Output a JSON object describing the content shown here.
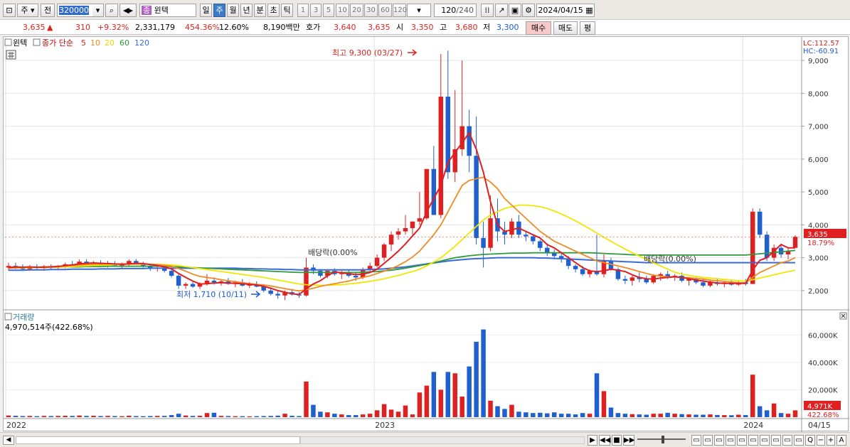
{
  "toolbar": {
    "period_label": "주",
    "prev_label": "전",
    "stock_code": "320000",
    "stock_badge": "종",
    "stock_name": "윈텍",
    "intervals": [
      "일",
      "주",
      "월",
      "년",
      "분",
      "초",
      "틱"
    ],
    "presets": [
      "1",
      "3",
      "5",
      "10",
      "20",
      "30",
      "60",
      "120"
    ],
    "count_value": "120",
    "count_total": "/240",
    "date_value": "2024/04/15"
  },
  "info": {
    "price": "3,635",
    "change": "310",
    "change_pct": "+9.32%",
    "volume": "2,331,179",
    "volume_ratio": "454.36%",
    "turnover": "12.60%",
    "amount": "8,190백만",
    "quote_label": "호가",
    "ask": "3,640",
    "bid": "3,635",
    "open_label": "시",
    "open": "3,350",
    "high_label": "고",
    "high": "3,680",
    "low_label": "저",
    "low": "3,300",
    "buy_label": "매수",
    "sell_label": "매도",
    "eval_label": "평"
  },
  "chart": {
    "legend_name": "윈텍",
    "legend_ma_title": "종가 단순",
    "legend_ma": [
      {
        "label": "5",
        "color": "#e02020"
      },
      {
        "label": "10",
        "color": "#f08a24"
      },
      {
        "label": "20",
        "color": "#f2e600"
      },
      {
        "label": "60",
        "color": "#2e9a3e"
      },
      {
        "label": "120",
        "color": "#3a6bd8"
      }
    ],
    "lc_label": "LC:112.57",
    "hc_label": "HC:-60.91",
    "price_ticks": [
      "9,000",
      "8,000",
      "7,000",
      "6,000",
      "5,000",
      "4,000",
      "3,000",
      "2,000"
    ],
    "price_tag": "3,635",
    "price_tag_pct": "18.79%",
    "high_note": "최고 9,300 (03/27)",
    "low_note": "최저 1,710 (10/11)",
    "div_note_1": "배당락(0.00%",
    "div_note_2": "배당락(0.00%)",
    "volume_title": "거래량",
    "volume_value": "4,970,514주(422.68%)",
    "volume_ticks": [
      "60,000K",
      "40,000K",
      "20,000K"
    ],
    "volume_tag": "4,971K",
    "volume_tag_pct": "422.68%",
    "x_labels": [
      "2022",
      "2023",
      "2024",
      "04/15"
    ],
    "colors": {
      "up": "#e02020",
      "down": "#1f5fd0"
    }
  },
  "chart_data": {
    "type": "candlestick",
    "title": "윈텍",
    "ylim": [
      1500,
      9500
    ],
    "volume_ylim": [
      0,
      70000
    ],
    "candles": [
      [
        2700,
        2850,
        2600,
        2750,
        1200
      ],
      [
        2750,
        2850,
        2650,
        2700,
        1000
      ],
      [
        2700,
        2800,
        2620,
        2650,
        800
      ],
      [
        2650,
        2780,
        2600,
        2720,
        900
      ],
      [
        2720,
        2800,
        2650,
        2680,
        700
      ],
      [
        2680,
        2780,
        2600,
        2740,
        900
      ],
      [
        2740,
        2800,
        2650,
        2700,
        800
      ],
      [
        2700,
        2780,
        2620,
        2750,
        900
      ],
      [
        2750,
        2850,
        2680,
        2800,
        1000
      ],
      [
        2800,
        2900,
        2720,
        2780,
        900
      ],
      [
        2780,
        2950,
        2700,
        2880,
        1200
      ],
      [
        2880,
        2950,
        2750,
        2800,
        900
      ],
      [
        2800,
        2900,
        2720,
        2850,
        1000
      ],
      [
        2850,
        2920,
        2750,
        2780,
        800
      ],
      [
        2780,
        2900,
        2700,
        2820,
        900
      ],
      [
        2820,
        2900,
        2740,
        2760,
        800
      ],
      [
        2760,
        2850,
        2680,
        2800,
        700
      ],
      [
        2800,
        2950,
        2750,
        2900,
        1000
      ],
      [
        2900,
        2960,
        2780,
        2820,
        800
      ],
      [
        2820,
        2880,
        2700,
        2740,
        700
      ],
      [
        2740,
        2800,
        2600,
        2660,
        800
      ],
      [
        2660,
        2750,
        2580,
        2700,
        900
      ],
      [
        2700,
        2760,
        2550,
        2600,
        900
      ],
      [
        2600,
        2650,
        2400,
        2450,
        1500
      ],
      [
        2450,
        2500,
        2050,
        2150,
        2500
      ],
      [
        2150,
        2250,
        2050,
        2200,
        1200
      ],
      [
        2200,
        2300,
        2080,
        2120,
        900
      ],
      [
        2120,
        2250,
        2050,
        2220,
        1000
      ],
      [
        2220,
        2500,
        2150,
        2300,
        3000
      ],
      [
        2300,
        2400,
        2180,
        2250,
        3200
      ],
      [
        2250,
        2350,
        2150,
        2280,
        900
      ],
      [
        2280,
        2380,
        2180,
        2200,
        800
      ],
      [
        2200,
        2300,
        2100,
        2250,
        700
      ],
      [
        2250,
        2350,
        2120,
        2150,
        700
      ],
      [
        2150,
        2260,
        2080,
        2200,
        600
      ],
      [
        2200,
        2280,
        2100,
        2120,
        700
      ],
      [
        2120,
        2200,
        1950,
        2000,
        800
      ],
      [
        2000,
        2100,
        1850,
        1900,
        900
      ],
      [
        1900,
        1980,
        1750,
        1850,
        1100
      ],
      [
        1850,
        2000,
        1710,
        1950,
        2500
      ],
      [
        1950,
        2050,
        1850,
        1880,
        1000
      ],
      [
        1880,
        1950,
        1780,
        1850,
        800
      ],
      [
        1850,
        3000,
        1820,
        2700,
        26000
      ],
      [
        2700,
        2800,
        2500,
        2600,
        9000
      ],
      [
        2600,
        2650,
        2400,
        2450,
        4000
      ],
      [
        2450,
        2650,
        2380,
        2600,
        3500
      ],
      [
        2600,
        2680,
        2450,
        2500,
        2500
      ],
      [
        2500,
        2600,
        2350,
        2550,
        2000
      ],
      [
        2550,
        2620,
        2400,
        2450,
        1500
      ],
      [
        2450,
        2550,
        2300,
        2400,
        1500
      ],
      [
        2400,
        2700,
        2350,
        2650,
        2000
      ],
      [
        2650,
        2850,
        2550,
        2750,
        2500
      ],
      [
        2750,
        3100,
        2700,
        3000,
        5000
      ],
      [
        3000,
        3450,
        2900,
        3400,
        9500
      ],
      [
        3400,
        3800,
        3200,
        3700,
        5500
      ],
      [
        3700,
        3900,
        3550,
        3800,
        4000
      ],
      [
        3800,
        4300,
        3700,
        3900,
        8500
      ],
      [
        3900,
        4100,
        3700,
        4100,
        2000
      ],
      [
        4100,
        5000,
        4000,
        4200,
        18000
      ],
      [
        4200,
        5200,
        4150,
        5700,
        23000
      ],
      [
        5700,
        6400,
        4300,
        4300,
        33000
      ],
      [
        4300,
        9200,
        4200,
        7900,
        20000
      ],
      [
        7900,
        9300,
        5400,
        5600,
        33000
      ],
      [
        5600,
        8100,
        5300,
        6300,
        32000
      ],
      [
        6300,
        9000,
        6100,
        7000,
        15000
      ],
      [
        7000,
        7500,
        5600,
        6100,
        37000
      ],
      [
        6100,
        7300,
        3400,
        3600,
        55000
      ],
      [
        3600,
        4100,
        2700,
        3300,
        64000
      ],
      [
        3300,
        4900,
        3200,
        4200,
        12000
      ],
      [
        4200,
        4800,
        3500,
        3800,
        8000
      ],
      [
        3800,
        4100,
        3400,
        3700,
        6000
      ],
      [
        3700,
        4200,
        3600,
        4100,
        9000
      ],
      [
        4100,
        4300,
        3600,
        3700,
        4000
      ],
      [
        3700,
        3800,
        3500,
        3650,
        3500
      ],
      [
        3650,
        3700,
        3400,
        3500,
        3000
      ],
      [
        3500,
        3550,
        3200,
        3300,
        3200
      ],
      [
        3300,
        3400,
        3050,
        3150,
        2800
      ],
      [
        3150,
        3250,
        2950,
        3050,
        3500
      ],
      [
        3050,
        3150,
        2850,
        2950,
        2500
      ],
      [
        2950,
        3050,
        2650,
        2750,
        2500
      ],
      [
        2750,
        2800,
        2550,
        2650,
        2000
      ],
      [
        2650,
        2750,
        2450,
        2500,
        3000
      ],
      [
        2500,
        2650,
        2400,
        2600,
        2500
      ],
      [
        2600,
        3700,
        2450,
        2500,
        32000
      ],
      [
        2500,
        3100,
        2400,
        2900,
        19000
      ],
      [
        2900,
        3000,
        2600,
        2650,
        7000
      ],
      [
        2650,
        2700,
        2300,
        2350,
        3000
      ],
      [
        2350,
        2450,
        2200,
        2300,
        2500
      ],
      [
        2300,
        2450,
        2150,
        2400,
        2200
      ],
      [
        2400,
        2550,
        2250,
        2350,
        2000
      ],
      [
        2350,
        2450,
        2200,
        2250,
        1800
      ],
      [
        2250,
        2500,
        2200,
        2450,
        2500
      ],
      [
        2450,
        2550,
        2300,
        2500,
        2500
      ],
      [
        2500,
        2600,
        2350,
        2400,
        3200
      ],
      [
        2400,
        2500,
        2300,
        2450,
        2500
      ],
      [
        2450,
        2550,
        2250,
        2300,
        2200
      ],
      [
        2300,
        2400,
        2150,
        2350,
        2000
      ],
      [
        2350,
        2400,
        2200,
        2250,
        1800
      ],
      [
        2250,
        2350,
        2100,
        2150,
        1800
      ],
      [
        2150,
        2300,
        2100,
        2250,
        2000
      ],
      [
        2250,
        2350,
        2150,
        2200,
        1600
      ],
      [
        2200,
        2300,
        2100,
        2250,
        1500
      ],
      [
        2250,
        2300,
        2150,
        2180,
        1400
      ],
      [
        2180,
        2300,
        2150,
        2250,
        1800
      ],
      [
        2250,
        2350,
        2150,
        2200,
        1500
      ],
      [
        2200,
        4500,
        2200,
        4400,
        31000
      ],
      [
        4400,
        4500,
        3600,
        3700,
        8000
      ],
      [
        3700,
        3800,
        2900,
        3000,
        5000
      ],
      [
        3000,
        3400,
        2900,
        3300,
        10000
      ],
      [
        3300,
        3400,
        3000,
        3100,
        3000
      ],
      [
        3100,
        3300,
        2950,
        3200,
        2500
      ],
      [
        3300,
        3680,
        3300,
        3635,
        4971
      ]
    ],
    "ma": {
      "5": [
        2700,
        2720,
        2710,
        2720,
        2710,
        2710,
        2720,
        2730,
        2760,
        2780,
        2810,
        2830,
        2840,
        2830,
        2820,
        2810,
        2800,
        2810,
        2830,
        2820,
        2790,
        2760,
        2720,
        2660,
        2520,
        2400,
        2290,
        2200,
        2210,
        2230,
        2240,
        2230,
        2220,
        2210,
        2190,
        2170,
        2130,
        2070,
        2000,
        1950,
        1900,
        1880,
        2050,
        2200,
        2300,
        2450,
        2570,
        2540,
        2510,
        2490,
        2500,
        2550,
        2650,
        2830,
        3010,
        3200,
        3420,
        3660,
        3900,
        4400,
        4800,
        5200,
        5900,
        6200,
        6500,
        6800,
        6300,
        5600,
        4700,
        4000,
        3800,
        3850,
        3900,
        3800,
        3700,
        3600,
        3400,
        3300,
        3150,
        3000,
        2850,
        2700,
        2600,
        2580,
        2600,
        2650,
        2620,
        2580,
        2480,
        2400,
        2360,
        2350,
        2380,
        2400,
        2420,
        2400,
        2360,
        2320,
        2290,
        2260,
        2230,
        2220,
        2220,
        2220,
        2220,
        2620,
        2920,
        3000,
        3200,
        3400,
        3300,
        3300
      ],
      "10": [
        2680,
        2690,
        2700,
        2710,
        2710,
        2720,
        2730,
        2740,
        2750,
        2760,
        2780,
        2790,
        2800,
        2810,
        2810,
        2810,
        2810,
        2810,
        2810,
        2810,
        2800,
        2790,
        2770,
        2740,
        2670,
        2590,
        2500,
        2430,
        2400,
        2370,
        2330,
        2300,
        2270,
        2240,
        2210,
        2190,
        2170,
        2140,
        2100,
        2060,
        2020,
        1990,
        2030,
        2070,
        2130,
        2170,
        2210,
        2250,
        2290,
        2350,
        2400,
        2450,
        2520,
        2590,
        2670,
        2760,
        2880,
        3020,
        3200,
        3450,
        3700,
        4000,
        4400,
        4800,
        5200,
        5350,
        5400,
        5450,
        5300,
        5100,
        4800,
        4600,
        4400,
        4200,
        4000,
        3800,
        3650,
        3500,
        3400,
        3300,
        3200,
        3100,
        3000,
        2900,
        2850,
        2800,
        2750,
        2700,
        2640,
        2580,
        2520,
        2470,
        2440,
        2420,
        2410,
        2400,
        2390,
        2370,
        2350,
        2320,
        2300,
        2280,
        2260,
        2240,
        2230,
        2400,
        2550,
        2650,
        2750,
        2850,
        2900,
        3000
      ],
      "20": [
        2680,
        2690,
        2690,
        2700,
        2700,
        2700,
        2710,
        2710,
        2720,
        2730,
        2740,
        2750,
        2760,
        2770,
        2780,
        2790,
        2800,
        2800,
        2800,
        2800,
        2800,
        2800,
        2790,
        2780,
        2760,
        2730,
        2700,
        2670,
        2640,
        2610,
        2580,
        2550,
        2520,
        2490,
        2460,
        2430,
        2400,
        2360,
        2320,
        2280,
        2240,
        2200,
        2180,
        2170,
        2160,
        2160,
        2170,
        2180,
        2200,
        2220,
        2250,
        2280,
        2320,
        2360,
        2410,
        2460,
        2520,
        2580,
        2650,
        2750,
        2870,
        3000,
        3170,
        3350,
        3550,
        3750,
        3950,
        4150,
        4300,
        4400,
        4500,
        4550,
        4600,
        4600,
        4580,
        4550,
        4500,
        4420,
        4330,
        4230,
        4120,
        4000,
        3880,
        3750,
        3620,
        3500,
        3380,
        3260,
        3150,
        3050,
        2950,
        2850,
        2750,
        2650,
        2560,
        2500,
        2460,
        2430,
        2400,
        2380,
        2360,
        2340,
        2320,
        2300,
        2290,
        2330,
        2380,
        2430,
        2480,
        2530,
        2580,
        2620
      ],
      "60": [
        2700,
        2700,
        2700,
        2700,
        2700,
        2710,
        2710,
        2710,
        2720,
        2720,
        2720,
        2730,
        2730,
        2730,
        2740,
        2740,
        2740,
        2740,
        2740,
        2740,
        2740,
        2740,
        2740,
        2730,
        2720,
        2710,
        2700,
        2690,
        2680,
        2670,
        2660,
        2650,
        2640,
        2630,
        2620,
        2610,
        2600,
        2590,
        2580,
        2570,
        2560,
        2550,
        2550,
        2550,
        2550,
        2550,
        2550,
        2550,
        2550,
        2550,
        2560,
        2570,
        2580,
        2600,
        2620,
        2650,
        2680,
        2720,
        2760,
        2800,
        2850,
        2900,
        2950,
        3000,
        3030,
        3060,
        3080,
        3100,
        3110,
        3120,
        3130,
        3140,
        3140,
        3140,
        3150,
        3150,
        3150,
        3150,
        3150,
        3150,
        3150,
        3150,
        3150,
        3140,
        3130,
        3120,
        3110,
        3100,
        3090,
        3080,
        3080,
        3080,
        3080,
        3080,
        3080,
        3080,
        3080,
        3080,
        3080,
        3080,
        3080,
        3080,
        3080,
        3080,
        3080,
        3100,
        3120,
        3140,
        3160,
        3180,
        3200,
        3220
      ],
      "120": [
        2620,
        2620,
        2620,
        2630,
        2630,
        2630,
        2640,
        2640,
        2640,
        2650,
        2650,
        2650,
        2650,
        2660,
        2660,
        2660,
        2670,
        2670,
        2670,
        2670,
        2680,
        2680,
        2680,
        2680,
        2680,
        2680,
        2680,
        2680,
        2680,
        2680,
        2680,
        2680,
        2680,
        2670,
        2670,
        2660,
        2660,
        2650,
        2650,
        2640,
        2640,
        2630,
        2630,
        2630,
        2630,
        2630,
        2630,
        2630,
        2630,
        2630,
        2630,
        2640,
        2650,
        2660,
        2680,
        2700,
        2720,
        2750,
        2780,
        2810,
        2840,
        2870,
        2900,
        2920,
        2940,
        2960,
        2970,
        2980,
        2990,
        3000,
        3000,
        3000,
        3000,
        3000,
        3000,
        2990,
        2990,
        2980,
        2970,
        2960,
        2950,
        2940,
        2930,
        2920,
        2910,
        2900,
        2890,
        2880,
        2870,
        2860,
        2850,
        2850,
        2850,
        2850,
        2850,
        2850,
        2850,
        2850,
        2850,
        2850,
        2850,
        2850,
        2850,
        2850,
        2850,
        2850,
        2850,
        2850,
        2850,
        2850,
        2850,
        2850
      ]
    }
  }
}
